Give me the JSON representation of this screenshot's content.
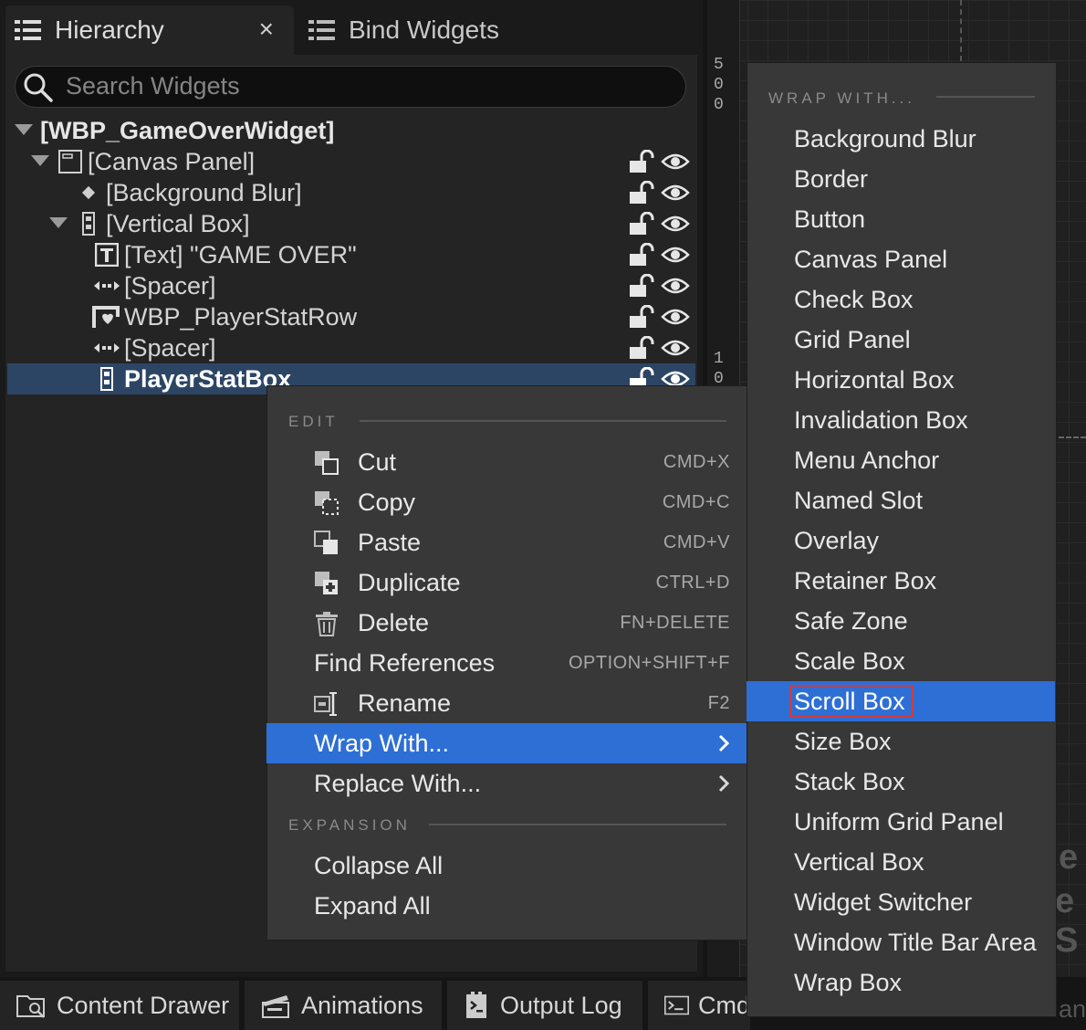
{
  "hierarchy_panel": {
    "tabs": [
      {
        "label": "Hierarchy",
        "icon": "list-icon",
        "closable": true,
        "close_glyph": "×"
      },
      {
        "label": "Bind Widgets",
        "icon": "list-icon"
      }
    ],
    "search": {
      "placeholder": "Search Widgets",
      "value": ""
    },
    "tree": [
      {
        "label": "[WBP_GameOverWidget]",
        "icon": "collapse-triangle",
        "root": true
      },
      {
        "label": "[Canvas Panel]",
        "icon": "canvas-panel-icon"
      },
      {
        "label": "[Background Blur]",
        "icon": "bullet-icon"
      },
      {
        "label": "[Vertical Box]",
        "icon": "vertical-box-icon"
      },
      {
        "label": "[Text] \"GAME OVER\"",
        "icon": "text-icon"
      },
      {
        "label": "[Spacer]",
        "icon": "spacer-icon"
      },
      {
        "label": "WBP_PlayerStatRow",
        "icon": "user-widget-icon"
      },
      {
        "label": "[Spacer]",
        "icon": "spacer-icon"
      },
      {
        "label": "PlayerStatBox",
        "icon": "vertical-box-icon",
        "selected": true
      }
    ]
  },
  "viewport": {
    "ruler_top": [
      "5",
      "0",
      "0"
    ],
    "ruler_mid": [
      "1",
      "0"
    ],
    "bg_text": [
      "e",
      "e S",
      "an"
    ]
  },
  "context_menu": {
    "edit_header": "EDIT",
    "items": [
      {
        "label": "Cut",
        "shortcut": "CMD+X",
        "icon": "cut-icon"
      },
      {
        "label": "Copy",
        "shortcut": "CMD+C",
        "icon": "copy-icon"
      },
      {
        "label": "Paste",
        "shortcut": "CMD+V",
        "icon": "paste-icon"
      },
      {
        "label": "Duplicate",
        "shortcut": "CTRL+D",
        "icon": "duplicate-icon"
      },
      {
        "label": "Delete",
        "shortcut": "FN+DELETE",
        "icon": "trash-icon"
      },
      {
        "label": "Find References",
        "shortcut": "OPTION+SHIFT+F"
      },
      {
        "label": "Rename",
        "shortcut": "F2",
        "icon": "rename-icon"
      },
      {
        "label": "Wrap With...",
        "submenu": true,
        "highlighted": true
      },
      {
        "label": "Replace With...",
        "submenu": true
      }
    ],
    "expansion_header": "EXPANSION",
    "expansion_items": [
      {
        "label": "Collapse All"
      },
      {
        "label": "Expand All"
      }
    ]
  },
  "wrap_submenu": {
    "header": "WRAP WITH...",
    "items": [
      "Background Blur",
      "Border",
      "Button",
      "Canvas Panel",
      "Check Box",
      "Grid Panel",
      "Horizontal Box",
      "Invalidation Box",
      "Menu Anchor",
      "Named Slot",
      "Overlay",
      "Retainer Box",
      "Safe Zone",
      "Scale Box",
      "Scroll Box",
      "Size Box",
      "Stack Box",
      "Uniform Grid Panel",
      "Vertical Box",
      "Widget Switcher",
      "Window Title Bar Area",
      "Wrap Box"
    ],
    "highlighted": "Scroll Box"
  },
  "bottom_bar": {
    "tabs": [
      {
        "label": "Content Drawer",
        "icon": "folder-icon"
      },
      {
        "label": "Animations",
        "icon": "film-icon"
      },
      {
        "label": "Output Log",
        "icon": "log-icon"
      },
      {
        "label": "Cmd",
        "icon": "terminal-icon"
      }
    ]
  },
  "colors": {
    "highlight": "#2e6fd6",
    "selected_row": "#2c4564",
    "menu_bg": "#383838",
    "panel_bg": "#242424",
    "annotation_red": "#d43a3a"
  }
}
